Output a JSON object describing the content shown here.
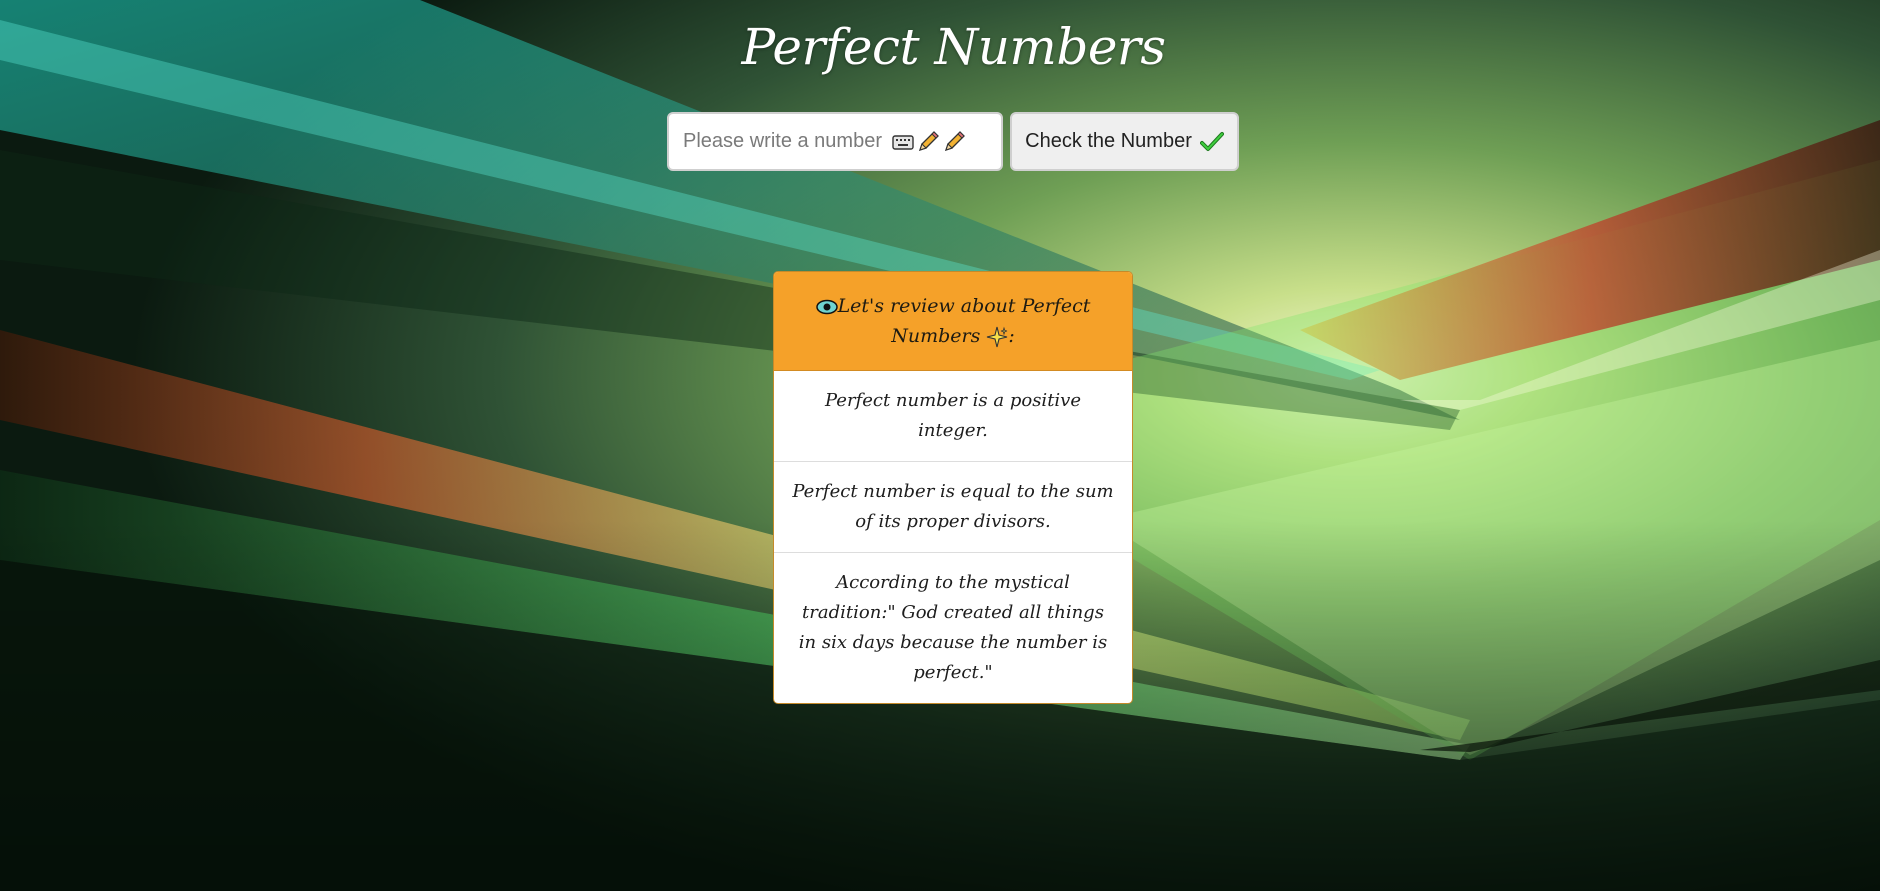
{
  "page": {
    "title": "Perfect Numbers"
  },
  "search": {
    "placeholder": "Please write a number",
    "icons": [
      "keyboard-icon",
      "pencil-icon",
      "pencil-icon"
    ]
  },
  "check_button": {
    "label": "Check the Number",
    "icon": "check-mark-icon"
  },
  "review_card": {
    "header_prefix": "Let's review about Perfect Numbers",
    "header_suffix": ":",
    "header_icons": [
      "eye-icon",
      "sparkles-icon"
    ],
    "facts": [
      "Perfect number is a positive integer.",
      "Perfect number is equal to the sum of its proper divisors.",
      "According to the mystical tradition:\" God created all things in six days because the number is perfect.\""
    ]
  },
  "colors": {
    "card_header": "#f5a129",
    "title_text": "#ffffff",
    "check_icon": "#2a9d2a"
  }
}
